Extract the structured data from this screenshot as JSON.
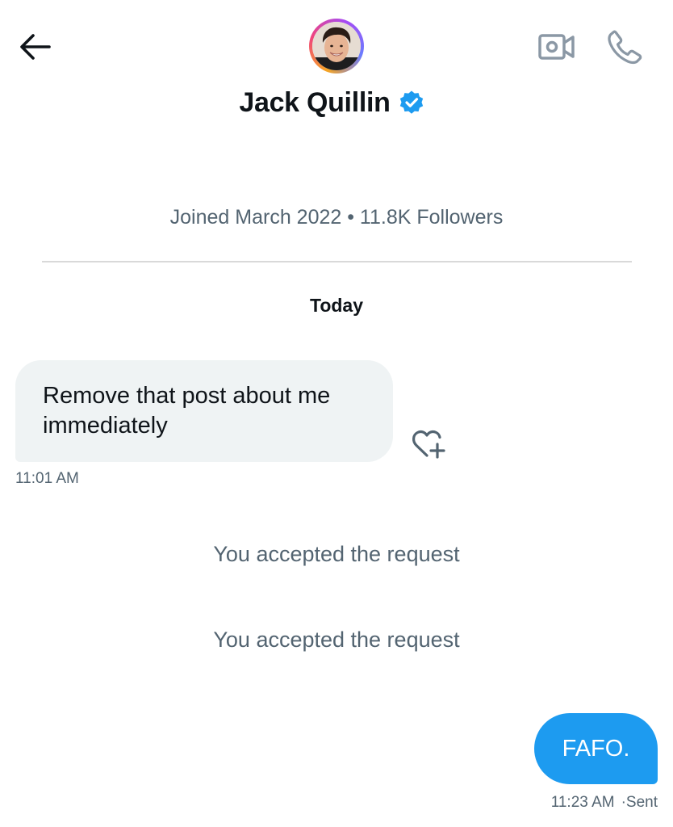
{
  "header": {
    "back_icon": "arrow-left-icon",
    "video_icon": "video-camera-icon",
    "call_icon": "phone-icon",
    "avatar_icon": "profile-photo",
    "contact_name": "Jack Quillin",
    "verified_icon": "verified-badge-icon",
    "verified_color": "#1d9bf0"
  },
  "profile": {
    "meta": "Joined March 2022 • 11.8K Followers"
  },
  "conversation": {
    "day_label": "Today",
    "messages": [
      {
        "direction": "received",
        "text": "Remove that post about me immediately",
        "line1": "Remove that post about me",
        "line2": "immediately",
        "time": "11:01 AM",
        "react_icon": "heart-plus-icon"
      },
      {
        "direction": "system",
        "text": "You accepted the request"
      },
      {
        "direction": "system",
        "text": "You accepted the request"
      },
      {
        "direction": "sent",
        "text": "FAFO.",
        "time": "11:23 AM",
        "status": "·Sent"
      }
    ]
  },
  "colors": {
    "accent": "#1d9bf0",
    "received_bubble": "#eff3f4",
    "secondary_text": "#536471",
    "icon_gray": "#8b98a5"
  }
}
